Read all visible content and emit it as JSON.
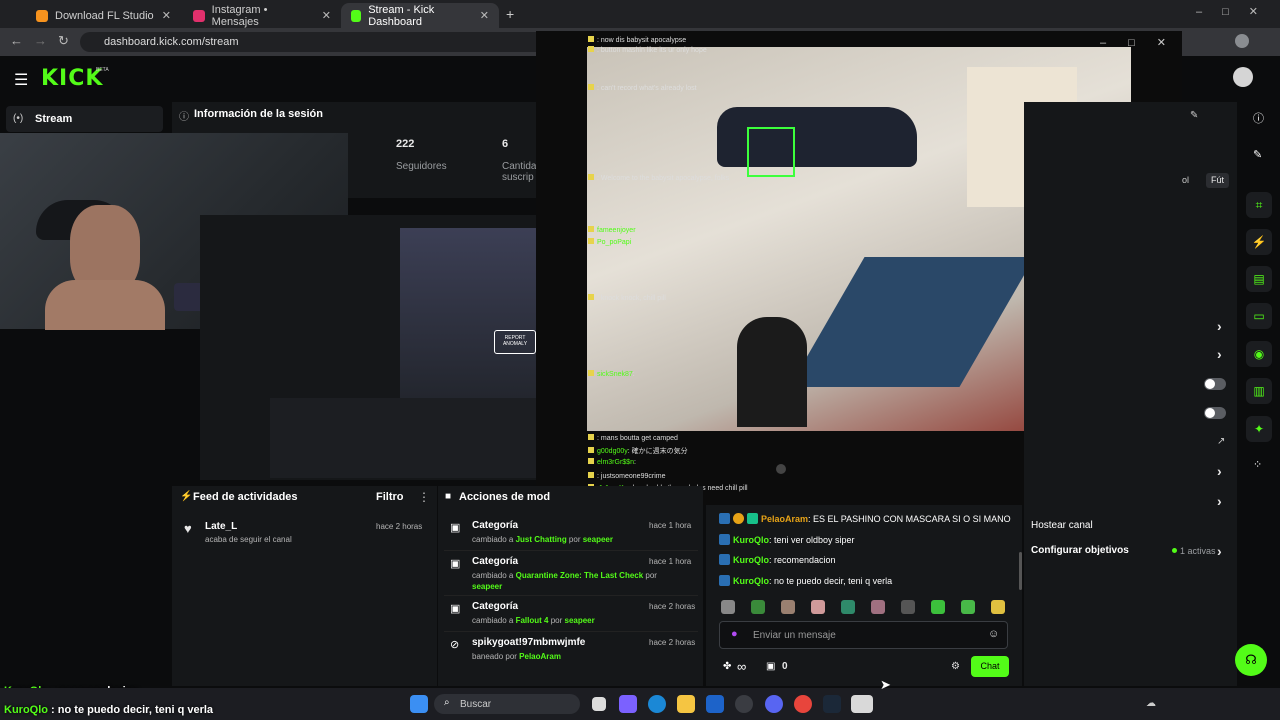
{
  "browser": {
    "tabs": [
      {
        "label": "Download FL Studio",
        "color": "#f7931e"
      },
      {
        "label": "Instagram • Mensajes",
        "color": "#e1306c"
      },
      {
        "label": "Stream - Kick Dashboard",
        "color": "#53fc18"
      }
    ],
    "url": "dashboard.kick.com/stream"
  },
  "kick": {
    "logo": "KICK",
    "beta": "BETA",
    "left_nav": {
      "stream_label": "Stream"
    },
    "session": {
      "title": "Información de la sesión",
      "stats": [
        {
          "value": "222",
          "label": "Seguidores"
        },
        {
          "value": "6",
          "label": "Cantida suscrip"
        }
      ]
    }
  },
  "popup": {
    "chat_lines": [
      {
        "user": "",
        "text": "now dis babysit apocalypse"
      },
      {
        "user": "",
        "text": "button mashin like its ur only hope"
      },
      {
        "user": "",
        "text": "can't record what's already lost"
      },
      {
        "user": "",
        "text": "Welcome to the babysit apocalypse, folks"
      },
      {
        "user": "fameenjoyer",
        "text": ""
      },
      {
        "user": "Po_poPapi",
        "text": ""
      },
      {
        "user": "",
        "text": "knock knock, chill pill"
      },
      {
        "user": "sickSnek87",
        "text": ""
      },
      {
        "user": "",
        "text": "mans boutta get camped"
      },
      {
        "user": "g00dg00y",
        "text": "確かに週末の気分"
      },
      {
        "user": "elm3rGr$$n",
        "text": ""
      },
      {
        "user": "",
        "text": "justsomeone99crime"
      },
      {
        "user": ":1r1er_K",
        "text": "whoa buddy these dudes need chill pill"
      }
    ]
  },
  "feed": {
    "title": "Feed de actividades",
    "filter": "Filtro",
    "items": [
      {
        "name": "Late_L",
        "desc": "acaba de seguir el canal",
        "time": "hace 2 horas"
      }
    ]
  },
  "mod": {
    "title": "Acciones de mod",
    "items": [
      {
        "title": "Categoría",
        "prefix": "cambiado a ",
        "target": "Just Chatting",
        "mid": " por ",
        "by": "seapeer",
        "time": "hace 1 hora"
      },
      {
        "title": "Categoría",
        "prefix": "cambiado a ",
        "target": "Quarantine Zone: The Last Check",
        "mid": " por ",
        "by": "seapeer",
        "time": "hace 1 hora"
      },
      {
        "title": "Categoría",
        "prefix": "cambiado a ",
        "target": "Fallout 4",
        "mid": " por ",
        "by": "seapeer",
        "time": "hace 2 horas"
      },
      {
        "title": "spikygoat!97mbmwjmfe",
        "prefix": "baneado por ",
        "target": "PelaoAram",
        "mid": "",
        "by": "",
        "time": "hace 2 horas"
      }
    ]
  },
  "chat": {
    "messages": [
      {
        "user": "PelaoAram",
        "text": "ES EL PASHINO CON MASCARA SI O SI MANO"
      },
      {
        "user": "KuroQlo",
        "text": "teni ver oldboy siper"
      },
      {
        "user": "KuroQlo",
        "text": "recomendacion"
      },
      {
        "user": "KuroQlo",
        "text": "no te puedo decir, teni q verla"
      }
    ],
    "placeholder": "Enviar un mensaje",
    "infinity": "∞",
    "count": "0",
    "send": "Chat"
  },
  "right": {
    "tabs": [
      "ol",
      "Fút"
    ],
    "host": "Hostear canal",
    "goals": "Configurar objetivos",
    "goals_active": "1 activas"
  },
  "overlay": [
    {
      "user": "KuroQlo",
      "text": "recomendacion"
    },
    {
      "user": "KuroQlo",
      "text": "no te puedo decir, teni q verla"
    }
  ],
  "taskbar": {
    "search": "Buscar"
  }
}
